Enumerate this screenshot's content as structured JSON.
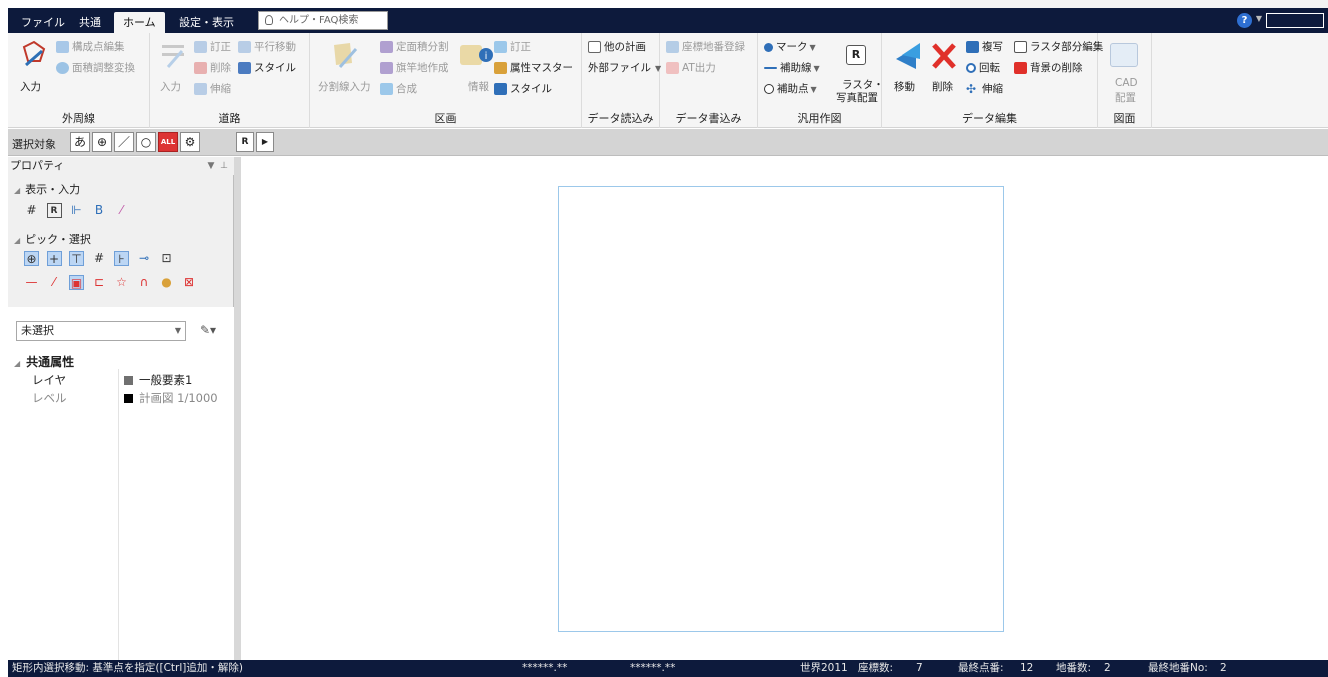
{
  "tabs": [
    {
      "label": "ファイル"
    },
    {
      "label": "共通"
    },
    {
      "label": "ホーム"
    },
    {
      "label": "設定・表示"
    }
  ],
  "help_search": {
    "placeholder": "ヘルプ・FAQ検索"
  },
  "ribbon": {
    "outline": {
      "label": "外周線",
      "input": "入力",
      "point_edit": "構成点編集",
      "area_adjust": "面積調整変換"
    },
    "road": {
      "label": "道路",
      "input": "入力",
      "correct": "訂正",
      "parallel_move": "平行移動",
      "delete": "削除",
      "style": "スタイル",
      "stretch": "伸縮"
    },
    "block": {
      "label": "区画",
      "split_line_input": "分割線入力",
      "fixed_area_split": "定面積分割",
      "flagpole_create": "旗竿地作成",
      "merge": "合成",
      "info": "情報",
      "correct": "訂正",
      "attr_master": "属性マスター",
      "style": "スタイル"
    },
    "data_read": {
      "label": "データ読込み",
      "other_plan": "他の計画",
      "external_file": "外部ファイル"
    },
    "data_write": {
      "label": "データ書込み",
      "coord_register": "座標地番登録",
      "at_output": "AT出力"
    },
    "general_draw": {
      "label": "汎用作図",
      "mark": "マーク",
      "aux_line": "補助線",
      "aux_point": "補助点",
      "raster_photo_1": "ラスタ・",
      "raster_photo_2": "写真配置"
    },
    "data_edit": {
      "label": "データ編集",
      "move": "移動",
      "delete": "削除",
      "copy": "複写",
      "rotate": "回転",
      "stretch": "伸縮",
      "raster_partial_edit": "ラスタ部分編集",
      "remove_background": "背景の削除"
    },
    "drawing": {
      "label": "図面",
      "cad_place_1": "CAD",
      "cad_place_2": "配置"
    }
  },
  "selection_bar": {
    "label": "選択対象",
    "buttons": [
      "あ",
      "⊕",
      "／",
      "○",
      "ALL",
      "⚙"
    ],
    "raster_btn": "R"
  },
  "properties": {
    "title": "プロパティ",
    "section_display": "表示・入力",
    "section_pick": "ピック・選択",
    "combo_value": "未選択",
    "common_header": "共通属性",
    "rows": [
      {
        "key": "レイヤ",
        "value": "一般要素1",
        "color": "#707070"
      },
      {
        "key": "レベル",
        "value": "計画図 1/1000",
        "color": "#000000"
      }
    ]
  },
  "status": {
    "message": "矩形内選択移動: 基準点を指定([Ctrl]追加・解除)",
    "coord_x": "******.**",
    "coord_y": "******.**",
    "datum": "世界2011",
    "coord_count_label": "座標数:",
    "coord_count": "7",
    "last_point_label": "最終点番:",
    "last_point": "12",
    "parcel_count_label": "地番数:",
    "parcel_count": "2",
    "last_parcel_label": "最終地番No:",
    "last_parcel": "2"
  }
}
